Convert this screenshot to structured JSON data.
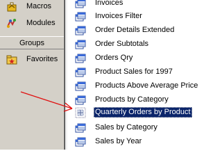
{
  "nav": {
    "macros_label": "Macros",
    "modules_label": "Modules",
    "groups_label": "Groups",
    "favorites_label": "Favorites"
  },
  "objects": {
    "items": [
      {
        "label": "Invoices",
        "icon": "query-icon"
      },
      {
        "label": "Invoices Filter",
        "icon": "query-icon"
      },
      {
        "label": "Order Details Extended",
        "icon": "query-icon"
      },
      {
        "label": "Order Subtotals",
        "icon": "query-icon"
      },
      {
        "label": "Orders Qry",
        "icon": "query-icon"
      },
      {
        "label": "Product Sales for 1997",
        "icon": "query-icon"
      },
      {
        "label": "Products Above Average Price",
        "icon": "query-icon"
      },
      {
        "label": "Products by Category",
        "icon": "query-icon"
      },
      {
        "label": "Quarterly Orders by Product",
        "icon": "crosstab-query-icon",
        "selected": true
      },
      {
        "label": "Sales by Category",
        "icon": "query-icon"
      },
      {
        "label": "Sales by Year",
        "icon": "query-icon"
      }
    ]
  },
  "colors": {
    "selection": "#0a246a",
    "annotation_arrow": "#e01010",
    "pane_background": "#d4d0c8"
  }
}
